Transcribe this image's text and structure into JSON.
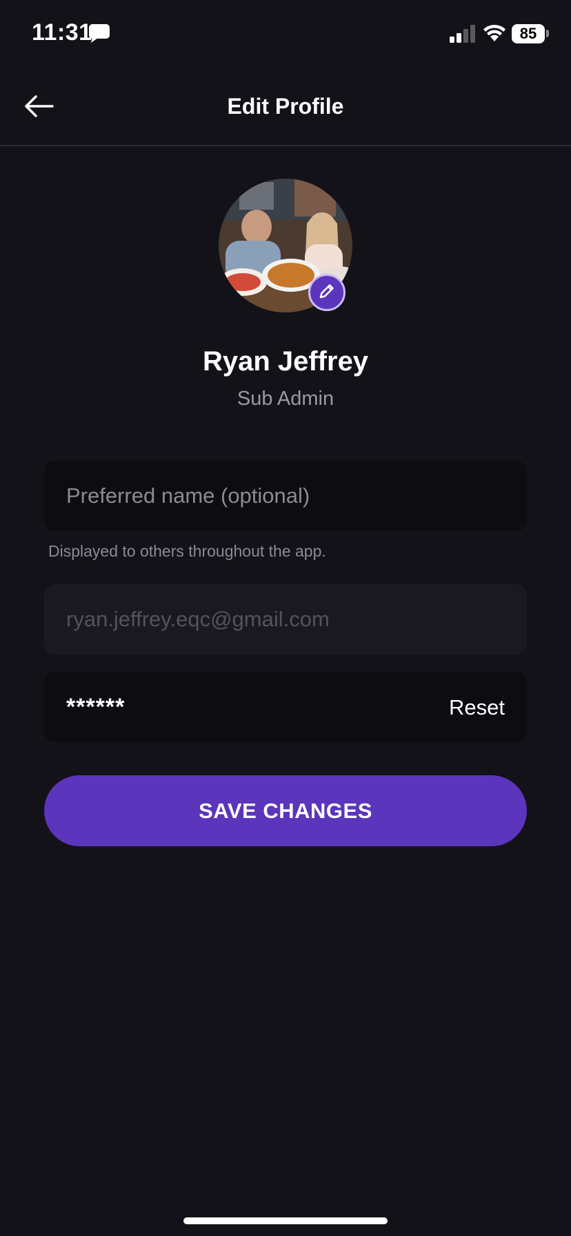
{
  "status_bar": {
    "time": "11:31",
    "battery": "85",
    "icons": [
      "message-icon",
      "signal-icon",
      "wifi-icon",
      "battery-icon"
    ]
  },
  "header": {
    "title": "Edit Profile",
    "back_icon": "arrow-left-icon"
  },
  "profile": {
    "name": "Ryan Jeffrey",
    "role": "Sub Admin",
    "edit_icon": "pencil-icon"
  },
  "form": {
    "preferred_name": {
      "placeholder": "Preferred name (optional)",
      "value": ""
    },
    "preferred_name_hint": "Displayed to others throughout the app.",
    "email": {
      "value": "ryan.jeffrey.eqc@gmail.com"
    },
    "password": {
      "masked": "******",
      "reset_label": "Reset"
    },
    "save_label": "SAVE CHANGES"
  },
  "colors": {
    "background": "#131218",
    "field": "#0d0c11",
    "field_disabled": "#1a1920",
    "accent": "#5b35bb",
    "muted_text": "#8c8b94"
  }
}
